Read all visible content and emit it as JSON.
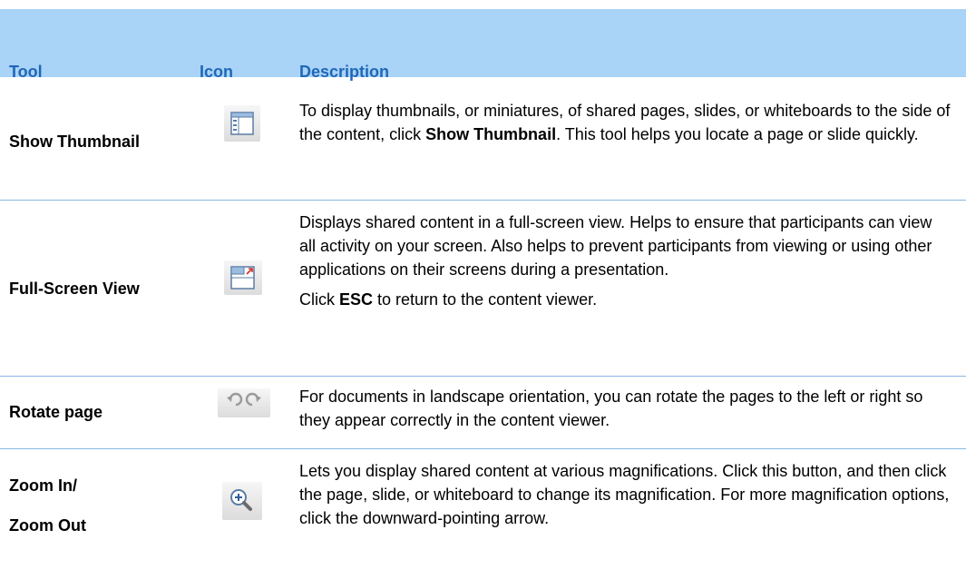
{
  "header": {
    "tool": "Tool",
    "icon": "Icon",
    "description": "Description"
  },
  "rows": [
    {
      "tool": "Show Thumbnail",
      "icon": "show-thumbnail-icon",
      "desc_before": "To display thumbnails, or miniatures, of shared pages, slides, or whiteboards to the side of the content, click ",
      "desc_bold": "Show Thumbnail",
      "desc_after": ". This tool helps you locate a page or slide quickly."
    },
    {
      "tool": "Full-Screen View",
      "icon": "full-screen-view-icon",
      "desc_para1": "Displays shared content in a full-screen view. Helps to ensure that participants can view all activity on your screen. Also helps to prevent participants from viewing or using other applications on their screens during a presentation.",
      "desc2_before": "Click ",
      "desc2_bold": "ESC",
      "desc2_after": " to return to the content viewer."
    },
    {
      "tool": "Rotate page",
      "icon": "rotate-left-right-icons",
      "desc": "For documents in landscape orientation, you can rotate the pages to the left or right so they appear correctly in the content viewer."
    },
    {
      "tool_line1": "Zoom In/",
      "tool_line2": "Zoom Out",
      "icon": "zoom-in-icon",
      "desc": "Lets you display shared content at various magnifications. Click this button, and then click the page, slide, or whiteboard to change its magnification. For more magnification options, click the downward-pointing arrow."
    }
  ],
  "colors": {
    "header_bg": "#a9d3f7",
    "header_text": "#1f67b8",
    "divider": "#86b7e4"
  }
}
